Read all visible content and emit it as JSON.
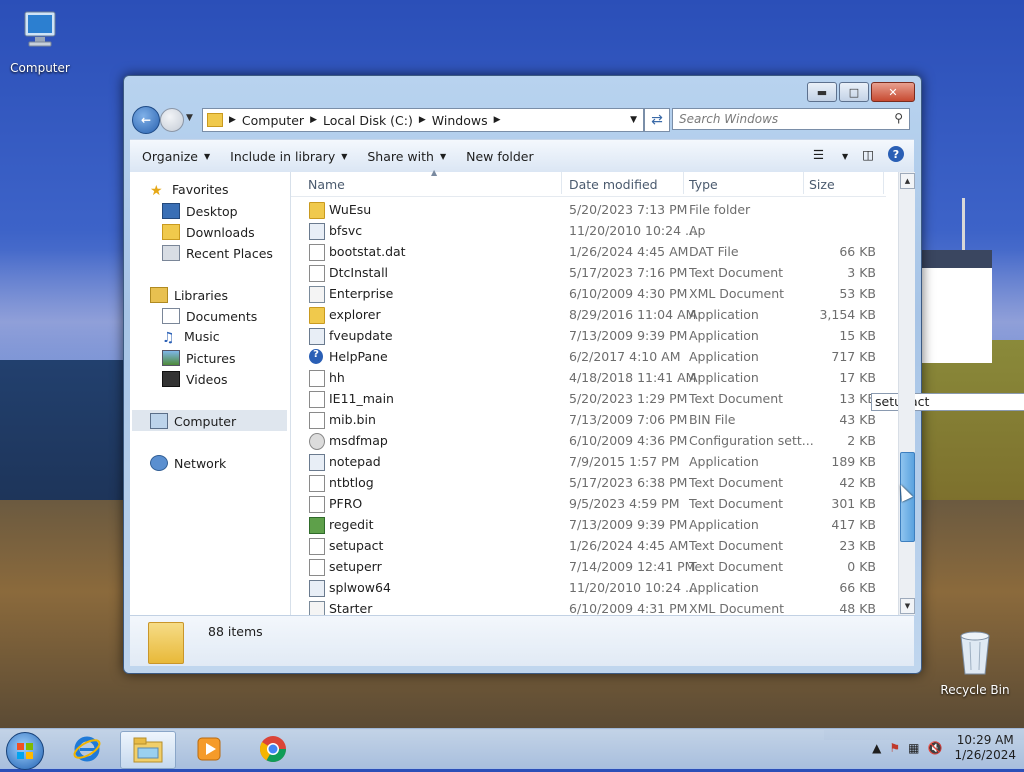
{
  "desktop": {
    "computer_label": "Computer",
    "recycle_label": "Recycle Bin"
  },
  "window": {
    "address": {
      "crumbs": [
        "Computer",
        "Local Disk (C:)",
        "Windows"
      ]
    },
    "search_placeholder": "Search Windows",
    "toolbar": {
      "organize": "Organize",
      "include": "Include in library",
      "share": "Share with",
      "new_folder": "New folder"
    },
    "nav": {
      "favorites": "Favorites",
      "desktop": "Desktop",
      "downloads": "Downloads",
      "recent": "Recent Places",
      "libraries": "Libraries",
      "documents": "Documents",
      "music": "Music",
      "pictures": "Pictures",
      "videos": "Videos",
      "computer": "Computer",
      "network": "Network"
    },
    "columns": {
      "name": "Name",
      "date": "Date modified",
      "type": "Type",
      "size": "Size"
    },
    "files": [
      {
        "name": "WuEsu",
        "date": "5/20/2023 7:13 PM",
        "type": "File folder",
        "size": "",
        "icon": "folder-icon"
      },
      {
        "name": "bfsvc",
        "date": "11/20/2010 10:24 ...",
        "type": "Ap",
        "size": "",
        "icon": "app-icon"
      },
      {
        "name": "bootstat.dat",
        "date": "1/26/2024 4:45 AM",
        "type": "DAT File",
        "size": "66 KB",
        "icon": "file-icon"
      },
      {
        "name": "DtcInstall",
        "date": "5/17/2023 7:16 PM",
        "type": "Text Document",
        "size": "3 KB",
        "icon": "file-icon"
      },
      {
        "name": "Enterprise",
        "date": "6/10/2009 4:30 PM",
        "type": "XML Document",
        "size": "53 KB",
        "icon": "xml-icon"
      },
      {
        "name": "explorer",
        "date": "8/29/2016 11:04 AM",
        "type": "Application",
        "size": "3,154 KB",
        "icon": "folder-icon"
      },
      {
        "name": "fveupdate",
        "date": "7/13/2009 9:39 PM",
        "type": "Application",
        "size": "15 KB",
        "icon": "app-icon"
      },
      {
        "name": "HelpPane",
        "date": "6/2/2017 4:10 AM",
        "type": "Application",
        "size": "717 KB",
        "icon": "help-icon"
      },
      {
        "name": "hh",
        "date": "4/18/2018 11:41 AM",
        "type": "Application",
        "size": "17 KB",
        "icon": "help-file-icon"
      },
      {
        "name": "IE11_main",
        "date": "5/20/2023 1:29 PM",
        "type": "Text Document",
        "size": "13 KB",
        "icon": "file-icon"
      },
      {
        "name": "mib.bin",
        "date": "7/13/2009 7:06 PM",
        "type": "BIN File",
        "size": "43 KB",
        "icon": "file-icon"
      },
      {
        "name": "msdfmap",
        "date": "6/10/2009 4:36 PM",
        "type": "Configuration sett...",
        "size": "2 KB",
        "icon": "gear-icon"
      },
      {
        "name": "notepad",
        "date": "7/9/2015 1:57 PM",
        "type": "Application",
        "size": "189 KB",
        "icon": "notepad-icon"
      },
      {
        "name": "ntbtlog",
        "date": "5/17/2023 6:38 PM",
        "type": "Text Document",
        "size": "42 KB",
        "icon": "file-icon"
      },
      {
        "name": "PFRO",
        "date": "9/5/2023 4:59 PM",
        "type": "Text Document",
        "size": "301 KB",
        "icon": "file-icon"
      },
      {
        "name": "regedit",
        "date": "7/13/2009 9:39 PM",
        "type": "Application",
        "size": "417 KB",
        "icon": "regedit-icon"
      },
      {
        "name": "setupact",
        "date": "1/26/2024 4:45 AM",
        "type": "Text Document",
        "size": "23 KB",
        "icon": "file-icon"
      },
      {
        "name": "setuperr",
        "date": "7/14/2009 12:41 PM",
        "type": "Text Document",
        "size": "0 KB",
        "icon": "file-icon"
      },
      {
        "name": "splwow64",
        "date": "11/20/2010 10:24 ...",
        "type": "Application",
        "size": "66 KB",
        "icon": "app-icon"
      },
      {
        "name": "Starter",
        "date": "6/10/2009 4:31 PM",
        "type": "XML Document",
        "size": "48 KB",
        "icon": "xml-icon"
      }
    ],
    "tooltip": "setupact",
    "status_count": "88 items"
  },
  "taskbar": {
    "time": "10:29 AM",
    "date": "1/26/2024"
  }
}
